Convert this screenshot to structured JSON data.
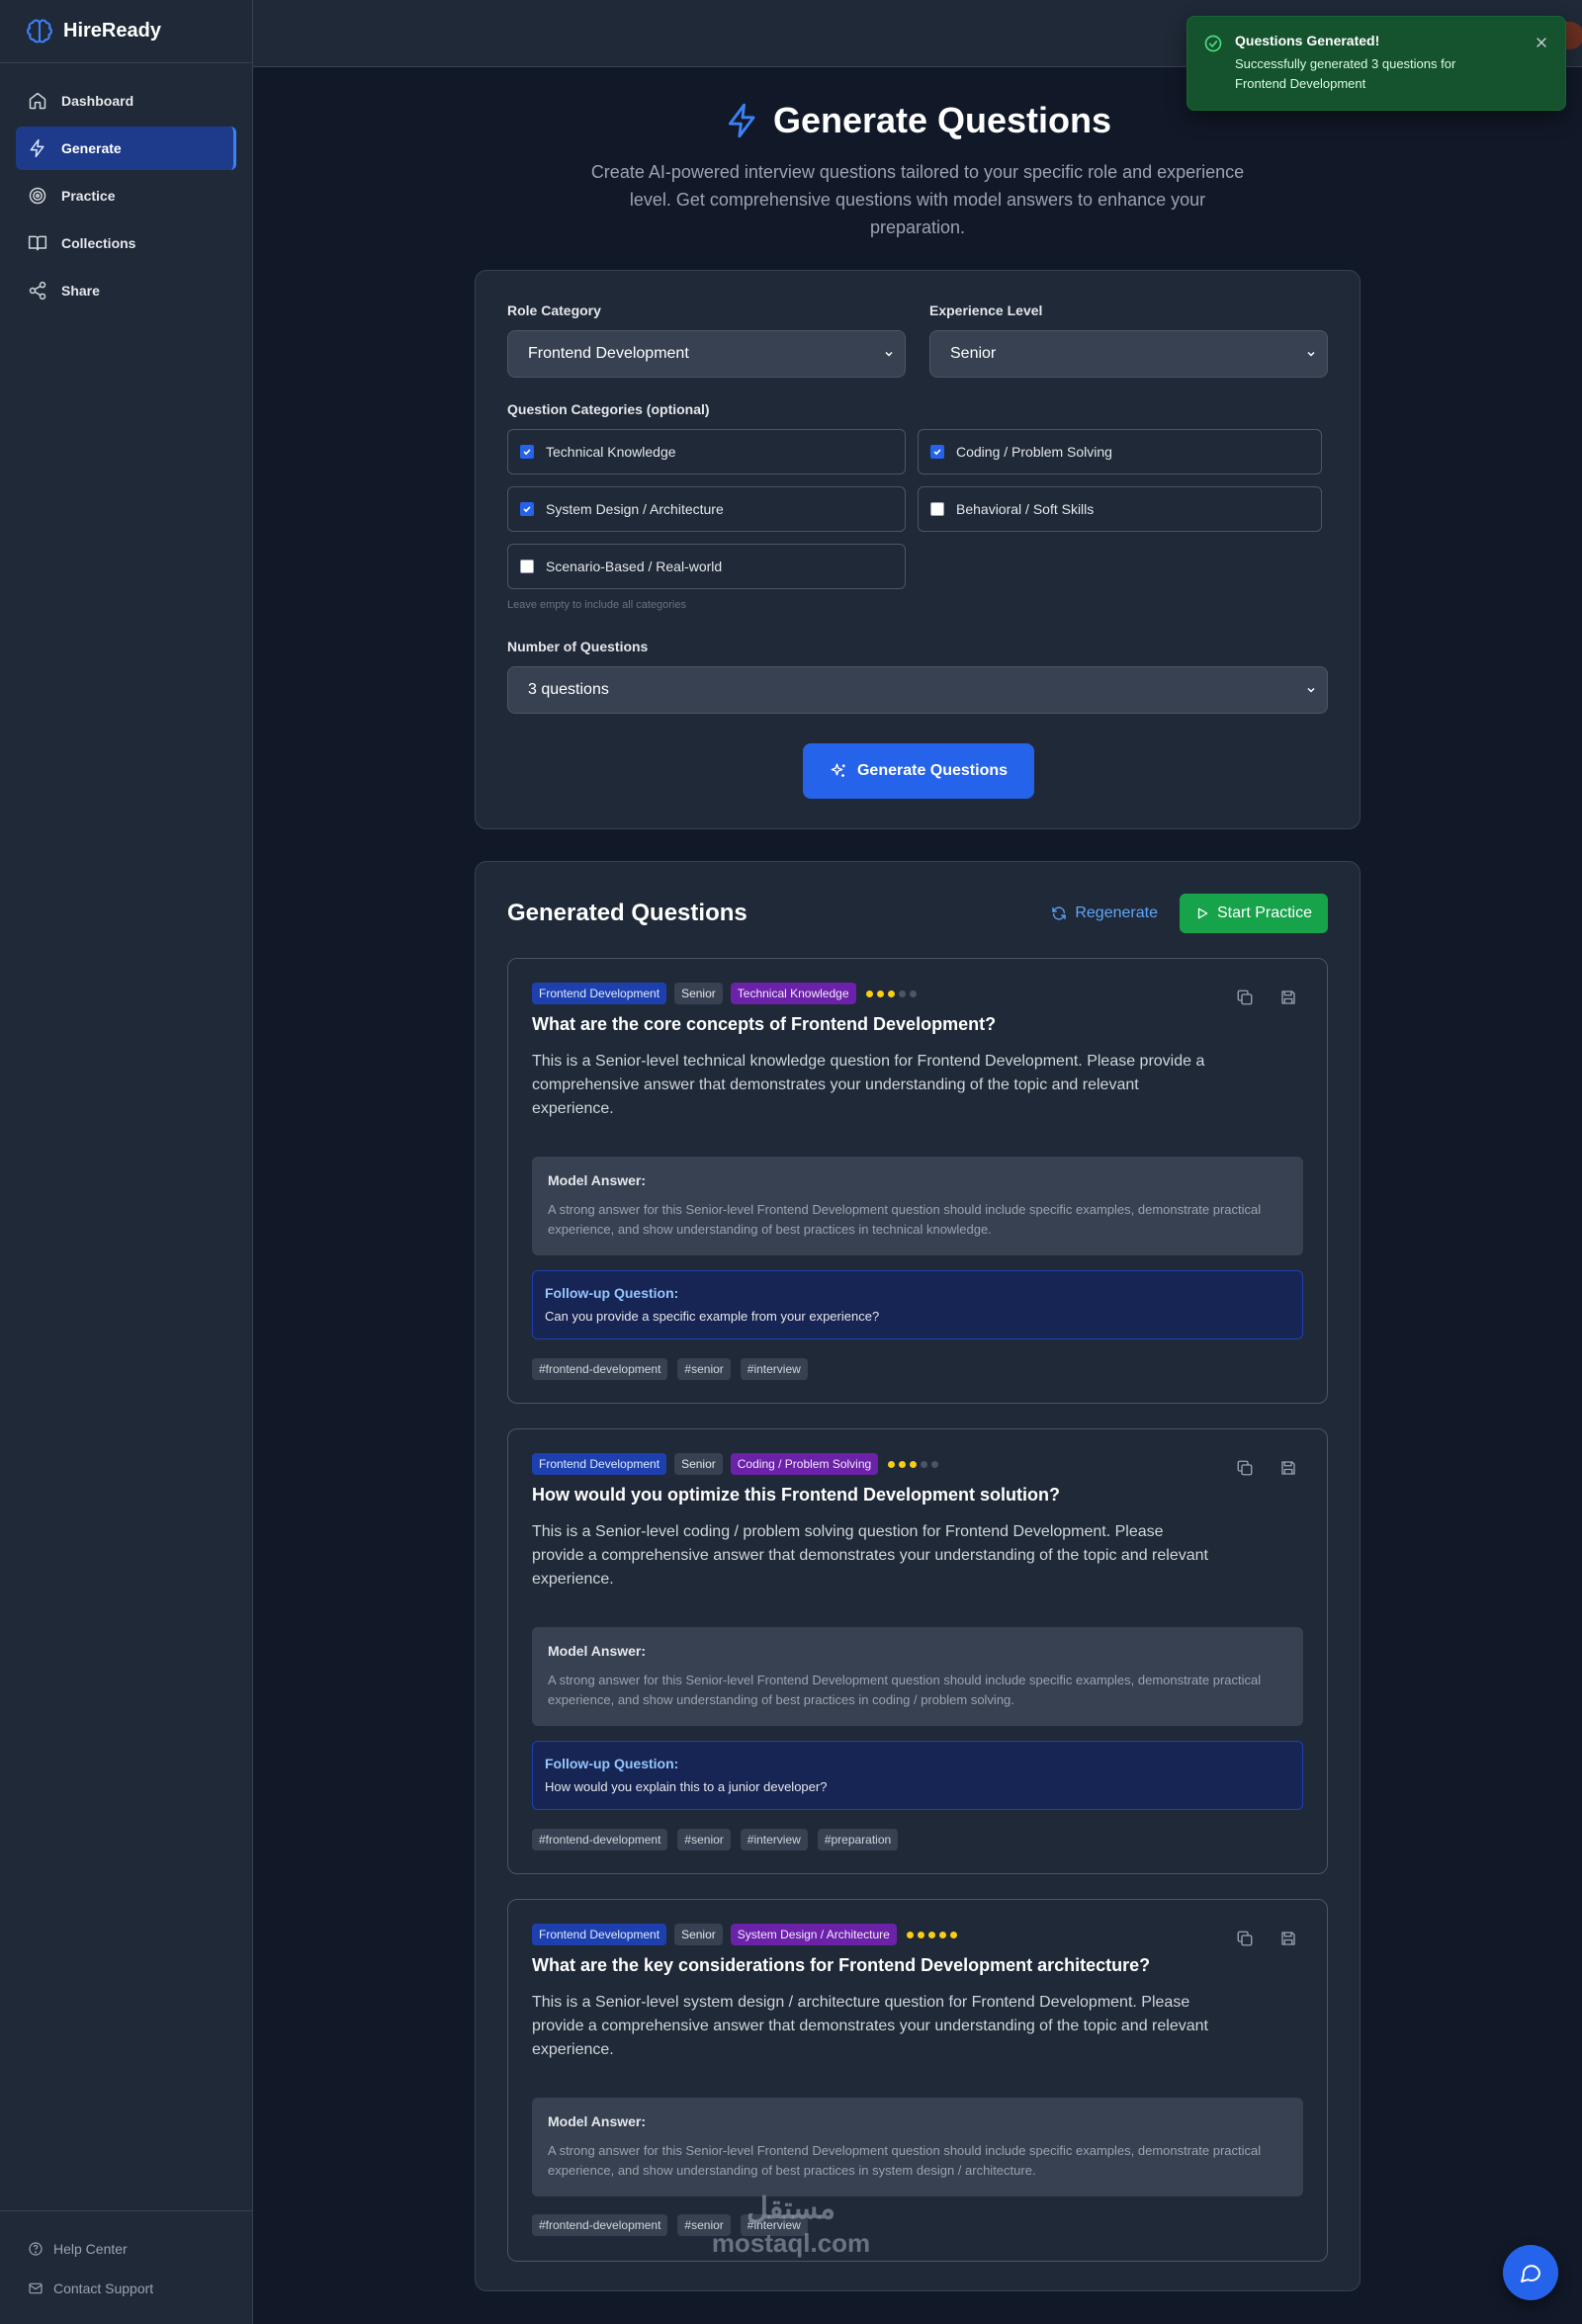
{
  "app": {
    "name": "HireReady"
  },
  "sidebar": {
    "items": [
      {
        "label": "Dashboard",
        "icon": "home-icon"
      },
      {
        "label": "Generate",
        "icon": "lightning-icon",
        "active": true
      },
      {
        "label": "Practice",
        "icon": "target-icon"
      },
      {
        "label": "Collections",
        "icon": "book-icon"
      },
      {
        "label": "Share",
        "icon": "share-icon"
      }
    ],
    "bottom": [
      {
        "label": "Help Center",
        "icon": "help-icon"
      },
      {
        "label": "Contact Support",
        "icon": "mail-icon"
      }
    ]
  },
  "toast": {
    "title": "Questions Generated!",
    "message": "Successfully generated 3 questions for Frontend Development"
  },
  "header": {
    "title": "Generate Questions",
    "subtitle": "Create AI-powered interview questions tailored to your specific role and experience level. Get comprehensive questions with model answers to enhance your preparation."
  },
  "form": {
    "role_label": "Role Category",
    "role_value": "Frontend Development",
    "level_label": "Experience Level",
    "level_value": "Senior",
    "categories_label": "Question Categories (optional)",
    "categories": [
      {
        "label": "Technical Knowledge",
        "checked": true
      },
      {
        "label": "Coding / Problem Solving",
        "checked": true
      },
      {
        "label": "System Design / Architecture",
        "checked": true
      },
      {
        "label": "Behavioral / Soft Skills",
        "checked": false
      },
      {
        "label": "Scenario-Based / Real-world",
        "checked": false
      }
    ],
    "categories_hint": "Leave empty to include all categories",
    "count_label": "Number of Questions",
    "count_value": "3 questions",
    "generate_label": "Generate Questions"
  },
  "results": {
    "title": "Generated Questions",
    "regenerate_label": "Regenerate",
    "start_label": "Start Practice",
    "model_answer_label": "Model Answer:",
    "followup_label": "Follow-up Question:",
    "questions": [
      {
        "role": "Frontend Development",
        "level": "Senior",
        "category": "Technical Knowledge",
        "difficulty": 3,
        "title": "What are the core concepts of Frontend Development?",
        "description": "This is a Senior-level technical knowledge question for Frontend Development. Please provide a comprehensive answer that demonstrates your understanding of the topic and relevant experience.",
        "model_answer": "A strong answer for this Senior-level Frontend Development question should include specific examples, demonstrate practical experience, and show understanding of best practices in technical knowledge.",
        "followup": "Can you provide a specific example from your experience?",
        "tags": [
          "#frontend-development",
          "#senior",
          "#interview"
        ]
      },
      {
        "role": "Frontend Development",
        "level": "Senior",
        "category": "Coding / Problem Solving",
        "difficulty": 3,
        "title": "How would you optimize this Frontend Development solution?",
        "description": "This is a Senior-level coding / problem solving question for Frontend Development. Please provide a comprehensive answer that demonstrates your understanding of the topic and relevant experience.",
        "model_answer": "A strong answer for this Senior-level Frontend Development question should include specific examples, demonstrate practical experience, and show understanding of best practices in coding / problem solving.",
        "followup": "How would you explain this to a junior developer?",
        "tags": [
          "#frontend-development",
          "#senior",
          "#interview",
          "#preparation"
        ]
      },
      {
        "role": "Frontend Development",
        "level": "Senior",
        "category": "System Design / Architecture",
        "difficulty": 5,
        "title": "What are the key considerations for Frontend Development architecture?",
        "description": "This is a Senior-level system design / architecture question for Frontend Development. Please provide a comprehensive answer that demonstrates your understanding of the topic and relevant experience.",
        "model_answer": "A strong answer for this Senior-level Frontend Development question should include specific examples, demonstrate practical experience, and show understanding of best practices in system design / architecture.",
        "tags": [
          "#frontend-development",
          "#senior",
          "#interview"
        ]
      }
    ]
  },
  "watermark": {
    "line1": "مستقل",
    "line2": "mostaql.com"
  },
  "colors": {
    "accent": "#2563eb",
    "success": "#16a34a",
    "background": "#111827",
    "surface": "#1f2937"
  }
}
